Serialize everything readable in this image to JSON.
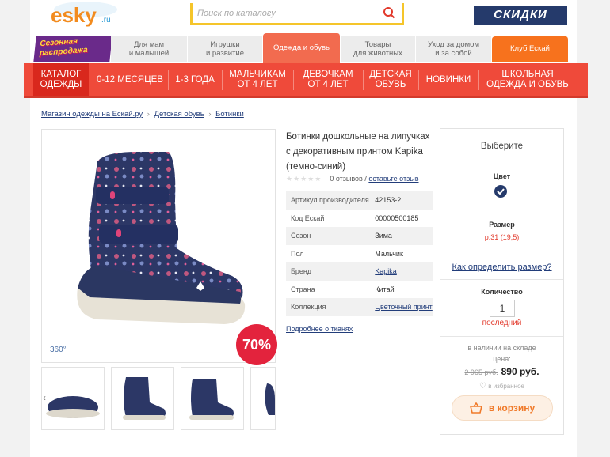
{
  "header": {
    "logo_text": "esky",
    "logo_suffix": ".ru",
    "search_placeholder": "Поиск по каталогу",
    "banner": "СКИДКИ"
  },
  "category_tabs": {
    "promo_line1": "Сезонная",
    "promo_line2": "распродажа",
    "items": [
      {
        "line1": "Для мам",
        "line2": "и малышей"
      },
      {
        "line1": "Игрушки",
        "line2": "и развитие"
      },
      {
        "line1": "Одежда и обувь",
        "line2": ""
      },
      {
        "line1": "Товары",
        "line2": "для животных"
      },
      {
        "line1": "Уход за домом",
        "line2": "и за собой"
      },
      {
        "line1": "Клуб Ескай",
        "line2": ""
      }
    ]
  },
  "nav": {
    "items": [
      {
        "line1": "КАТАЛОГ",
        "line2": "ОДЕЖДЫ"
      },
      {
        "line1": "0-12 МЕСЯЦЕВ",
        "line2": ""
      },
      {
        "line1": "1-3 ГОДА",
        "line2": ""
      },
      {
        "line1": "МАЛЬЧИКАМ",
        "line2": "ОТ 4 ЛЕТ"
      },
      {
        "line1": "ДЕВОЧКАМ",
        "line2": "ОТ 4 ЛЕТ"
      },
      {
        "line1": "ДЕТСКАЯ",
        "line2": "ОБУВЬ"
      },
      {
        "line1": "НОВИНКИ",
        "line2": ""
      },
      {
        "line1": "ШКОЛЬНАЯ",
        "line2": "ОДЕЖДА И ОБУВЬ"
      }
    ]
  },
  "breadcrumb": {
    "items": [
      "Магазин одежды на Ескай.ру",
      "Детская обувь",
      "Ботинки"
    ],
    "separator": "›"
  },
  "gallery": {
    "label_360": "360°",
    "discount": "70%"
  },
  "product": {
    "title": "Ботинки дошкольные на липучках с декоративным принтом Kapika (темно-синий)",
    "reviews_count": "0 отзывов",
    "reviews_sep": " / ",
    "leave_review": "оставьте отзыв",
    "attributes": [
      {
        "name": "Артикул производителя",
        "value": "42153-2",
        "link": false
      },
      {
        "name": "Код Ескай",
        "value": "00000500185",
        "link": false
      },
      {
        "name": "Сезон",
        "value": "Зима",
        "link": false
      },
      {
        "name": "Пол",
        "value": "Мальчик",
        "link": false
      },
      {
        "name": "Бренд",
        "value": "Kapika",
        "link": true
      },
      {
        "name": "Страна",
        "value": "Китай",
        "link": false
      },
      {
        "name": "Коллекция",
        "value": "Цветочный принт",
        "link": true
      }
    ],
    "fabric_link": "Подробнее о тканях"
  },
  "buybox": {
    "choose": "Выберите",
    "color_label": "Цвет",
    "color_value": "#253a6b",
    "size_label": "Размер",
    "size_value": "р.31 (19,5)",
    "size_help": "Как определить размер?",
    "qty_label": "Количество",
    "qty_value": "1",
    "qty_note": "последний",
    "stock": "в наличии на складе",
    "price_label": "цена:",
    "old_price": "2 965 руб.",
    "new_price": "890 руб.",
    "favorites": "в избранное",
    "cart_button": "в корзину"
  },
  "colors": {
    "nav_red": "#ef4a3a",
    "tab_active": "#f26b4f",
    "club_orange": "#f7721d",
    "brand_navy": "#253a6b",
    "sale_red": "#e3233d"
  }
}
